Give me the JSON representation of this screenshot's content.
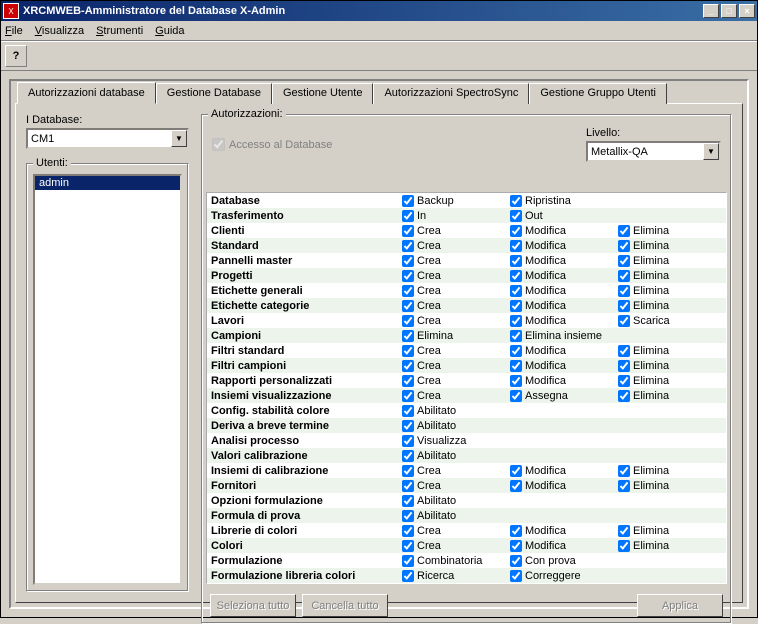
{
  "window": {
    "title": "XRCMWEB-Amministratore del Database X-Admin"
  },
  "menu": {
    "file": "File",
    "view": "Visualizza",
    "tools": "Strumenti",
    "help": "Guida"
  },
  "help_icon": "?",
  "tabs": {
    "auth_db": "Autorizzazioni database",
    "manage_db": "Gestione Database",
    "manage_user": "Gestione Utente",
    "auth_spectro": "Autorizzazioni SpectroSync",
    "manage_groups": "Gestione Gruppo Utenti"
  },
  "left": {
    "db_label": "I Database:",
    "db_value": "CM1",
    "users_label": "Utenti:",
    "users": [
      "admin"
    ]
  },
  "auth": {
    "group_label": "Autorizzazioni:",
    "access_label": "Accesso al Database",
    "access_checked": true,
    "level_label": "Livello:",
    "level_value": "Metallix-QA"
  },
  "buttons": {
    "select_all": "Seleziona tutto",
    "clear_all": "Cancella tutto",
    "apply": "Applica"
  },
  "rows": [
    {
      "name": "Database",
      "perms": [
        [
          "Backup",
          true
        ],
        [
          "Ripristina",
          true
        ]
      ]
    },
    {
      "name": "Trasferimento",
      "perms": [
        [
          "In",
          true
        ],
        [
          "Out",
          true
        ]
      ]
    },
    {
      "name": "Clienti",
      "perms": [
        [
          "Crea",
          true
        ],
        [
          "Modifica",
          true
        ],
        [
          "Elimina",
          true
        ]
      ]
    },
    {
      "name": "Standard",
      "perms": [
        [
          "Crea",
          true
        ],
        [
          "Modifica",
          true
        ],
        [
          "Elimina",
          true
        ]
      ]
    },
    {
      "name": "Pannelli master",
      "perms": [
        [
          "Crea",
          true
        ],
        [
          "Modifica",
          true
        ],
        [
          "Elimina",
          true
        ]
      ]
    },
    {
      "name": "Progetti",
      "perms": [
        [
          "Crea",
          true
        ],
        [
          "Modifica",
          true
        ],
        [
          "Elimina",
          true
        ]
      ]
    },
    {
      "name": "Etichette generali",
      "perms": [
        [
          "Crea",
          true
        ],
        [
          "Modifica",
          true
        ],
        [
          "Elimina",
          true
        ]
      ]
    },
    {
      "name": "Etichette categorie",
      "perms": [
        [
          "Crea",
          true
        ],
        [
          "Modifica",
          true
        ],
        [
          "Elimina",
          true
        ]
      ]
    },
    {
      "name": "Lavori",
      "perms": [
        [
          "Crea",
          true
        ],
        [
          "Modifica",
          true
        ],
        [
          "Scarica",
          true
        ]
      ]
    },
    {
      "name": "Campioni",
      "perms": [
        [
          "Elimina",
          true
        ],
        [
          "Elimina insieme",
          true
        ]
      ]
    },
    {
      "name": "Filtri standard",
      "perms": [
        [
          "Crea",
          true
        ],
        [
          "Modifica",
          true
        ],
        [
          "Elimina",
          true
        ]
      ]
    },
    {
      "name": "Filtri campioni",
      "perms": [
        [
          "Crea",
          true
        ],
        [
          "Modifica",
          true
        ],
        [
          "Elimina",
          true
        ]
      ]
    },
    {
      "name": "Rapporti personalizzati",
      "perms": [
        [
          "Crea",
          true
        ],
        [
          "Modifica",
          true
        ],
        [
          "Elimina",
          true
        ]
      ]
    },
    {
      "name": "Insiemi visualizzazione",
      "perms": [
        [
          "Crea",
          true
        ],
        [
          "Assegna",
          true
        ],
        [
          "Elimina",
          true
        ]
      ]
    },
    {
      "name": "Config. stabilità colore",
      "perms": [
        [
          "Abilitato",
          true
        ]
      ]
    },
    {
      "name": "Deriva a breve termine",
      "perms": [
        [
          "Abilitato",
          true
        ]
      ]
    },
    {
      "name": "Analisi processo",
      "perms": [
        [
          "Visualizza",
          true
        ]
      ]
    },
    {
      "name": "Valori calibrazione",
      "perms": [
        [
          "Abilitato",
          true
        ]
      ]
    },
    {
      "name": "Insiemi di calibrazione",
      "perms": [
        [
          "Crea",
          true
        ],
        [
          "Modifica",
          true
        ],
        [
          "Elimina",
          true
        ]
      ]
    },
    {
      "name": "Fornitori",
      "perms": [
        [
          "Crea",
          true
        ],
        [
          "Modifica",
          true
        ],
        [
          "Elimina",
          true
        ]
      ]
    },
    {
      "name": "Opzioni formulazione",
      "perms": [
        [
          "Abilitato",
          true
        ]
      ]
    },
    {
      "name": "Formula di prova",
      "perms": [
        [
          "Abilitato",
          true
        ]
      ]
    },
    {
      "name": "Librerie di colori",
      "perms": [
        [
          "Crea",
          true
        ],
        [
          "Modifica",
          true
        ],
        [
          "Elimina",
          true
        ]
      ]
    },
    {
      "name": "Colori",
      "perms": [
        [
          "Crea",
          true
        ],
        [
          "Modifica",
          true
        ],
        [
          "Elimina",
          true
        ]
      ]
    },
    {
      "name": "Formulazione",
      "perms": [
        [
          "Combinatoria",
          true
        ],
        [
          "Con prova",
          true
        ]
      ]
    },
    {
      "name": "Formulazione libreria colori",
      "perms": [
        [
          "Ricerca",
          true
        ],
        [
          "Correggere",
          true
        ]
      ]
    }
  ]
}
